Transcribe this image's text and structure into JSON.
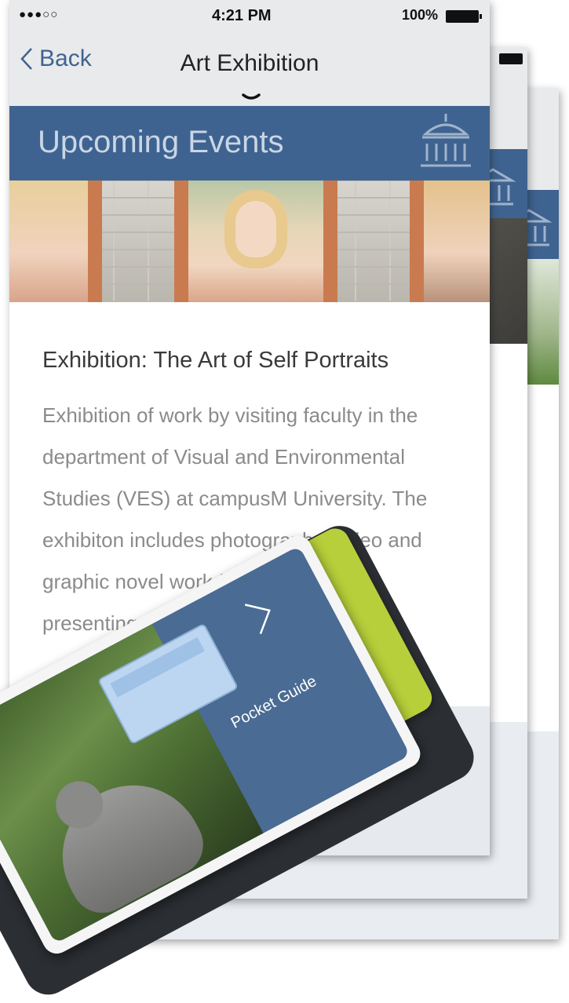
{
  "statusbar": {
    "signal": "●●●○○",
    "time": "4:21 PM",
    "battery": "100%"
  },
  "navbar": {
    "back_label": "Back",
    "title": "Art Exhibition"
  },
  "banner": {
    "title": "Upcoming Events",
    "icon": "museum-icon"
  },
  "event": {
    "title": "Exhibition: The Art of Self Portraits",
    "description": "Exhibition of work by visiting faculty in the department of Visual and Environmental Studies (VES) at campusM University. The exhibiton includes photography, video and graphic novel work from a range of presenting artists."
  },
  "card": {
    "label": "Pocket Guide"
  },
  "colors": {
    "banner": "#3f6390",
    "bar": "#e9eaec",
    "accent_green": "#b7cf3a",
    "card_blue": "#4a6b93"
  }
}
